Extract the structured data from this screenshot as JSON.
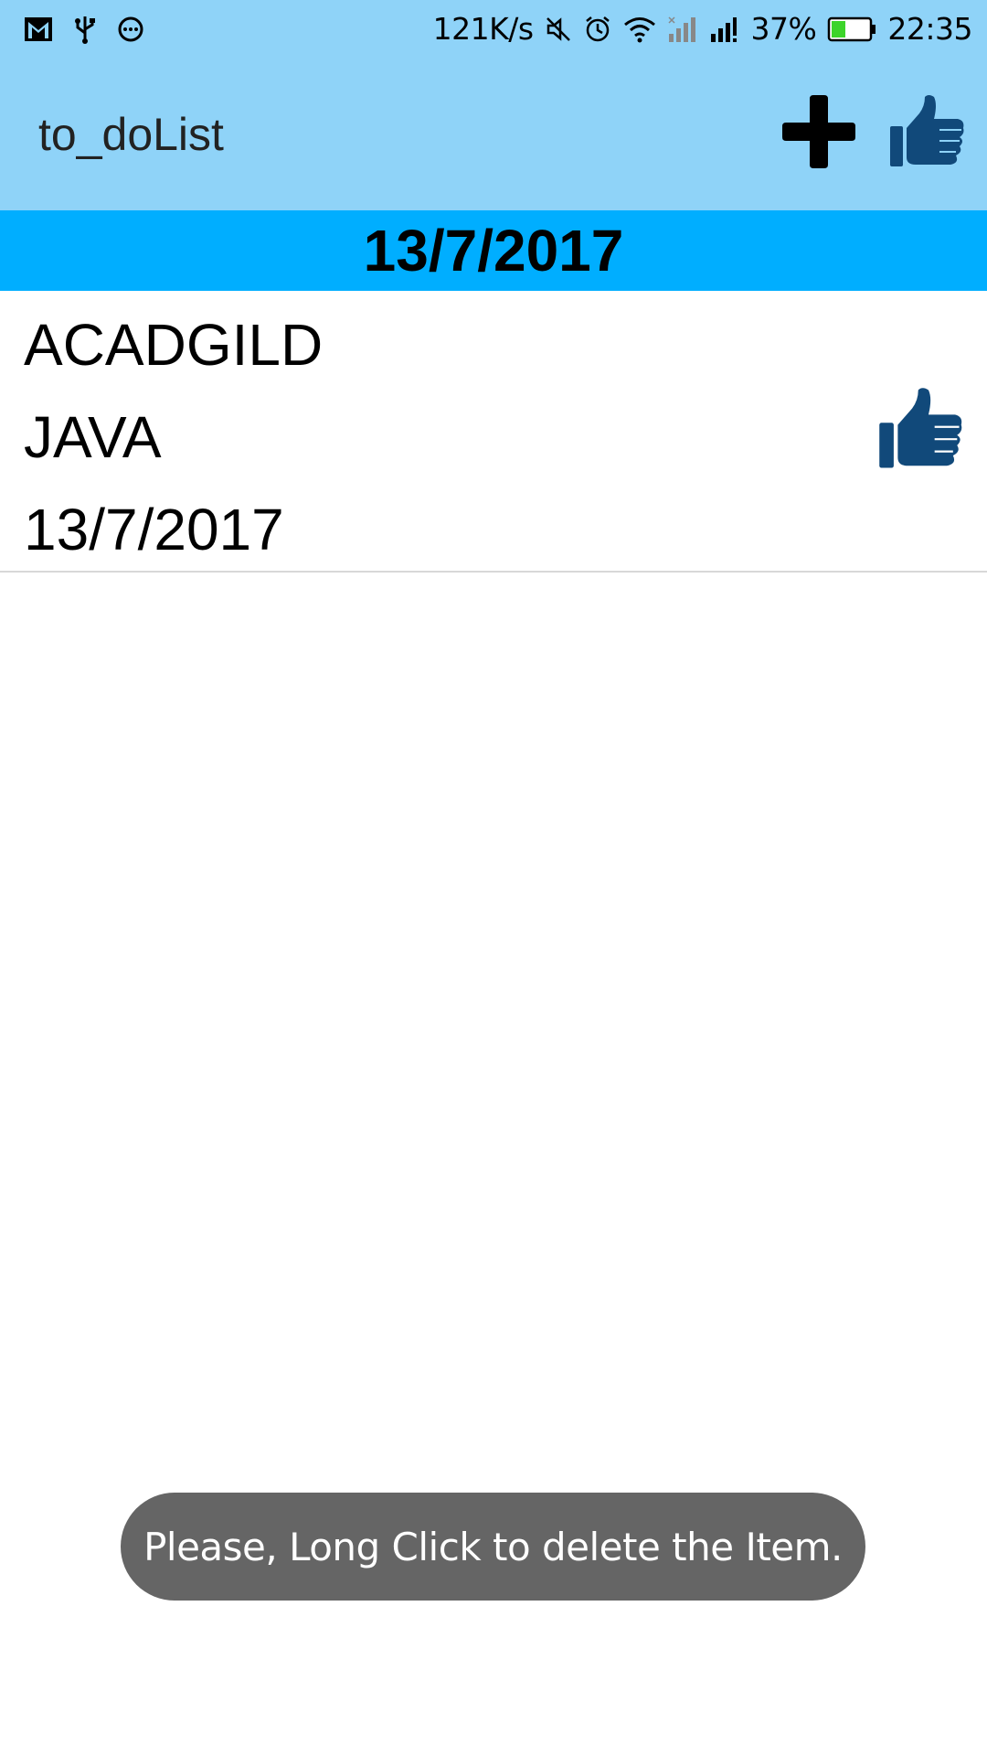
{
  "status_bar": {
    "icons_left": [
      "gmail-icon",
      "usb-icon",
      "chat-icon"
    ],
    "net_speed": "121K/s",
    "icons_right": [
      "mute-icon",
      "alarm-icon",
      "wifi-icon",
      "signal-1-icon",
      "signal-2-icon"
    ],
    "battery_percent": "37%",
    "battery_level": 0.37,
    "time": "22:35"
  },
  "app_bar": {
    "title": "to_doList",
    "actions": [
      "add-icon",
      "thumbs-up-icon"
    ]
  },
  "date_header": "13/7/2017",
  "items": [
    {
      "title": "ACADGILD",
      "description": "JAVA",
      "date": "13/7/2017",
      "icon": "thumbs-up-icon"
    }
  ],
  "toast": "Please, Long Click to delete the Item.",
  "colors": {
    "status_bar_bg": "#8fd3f8",
    "app_bar_bg": "#8fd3f8",
    "date_header_bg": "#00aeff",
    "icon_blue": "#11497a",
    "toast_bg": "#656565",
    "battery_green": "#3cd42a"
  }
}
